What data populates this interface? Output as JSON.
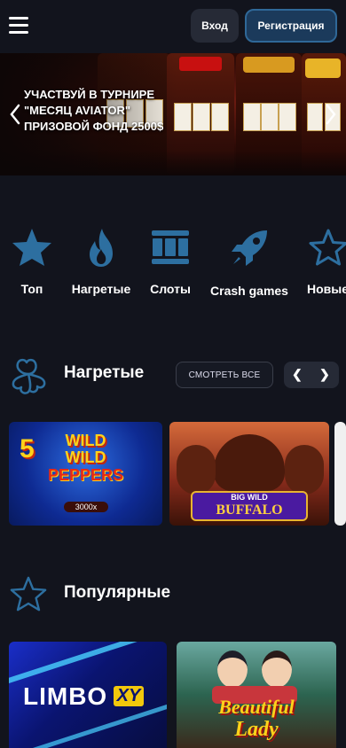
{
  "header": {
    "menu_icon": "hamburger-icon",
    "login_label": "Вход",
    "register_label": "Регистрация"
  },
  "banner": {
    "line1": "УЧАСТВУЙ В ТУРНИРЕ",
    "line2": "\"МЕСЯЦ AVIATOR\"",
    "line3": "ПРИЗОВОЙ ФОНД 2500$"
  },
  "categories": [
    {
      "label": "Топ",
      "icon": "star-icon"
    },
    {
      "label": "Нагретые",
      "icon": "flame-icon"
    },
    {
      "label": "Слоты",
      "icon": "slots-icon"
    },
    {
      "label": "Crash games",
      "icon": "rocket-icon"
    },
    {
      "label": "Новые",
      "icon": "star-outline-icon"
    }
  ],
  "sections": {
    "hot": {
      "title": "Нагретые",
      "see_all": "СМОТРЕТЬ ВСЕ",
      "icon": "clover-icon"
    },
    "popular": {
      "title": "Популярные",
      "icon": "star-outline-icon"
    }
  },
  "games": {
    "hot": [
      {
        "line1": "5",
        "line2": "WILD",
        "line3": "WILD",
        "line4": "PEPPERS",
        "badge": "3000x"
      },
      {
        "line1": "BIG WILD",
        "line2": "BUFFALO"
      }
    ],
    "popular": [
      {
        "line1": "LIMBO",
        "line2": "XY"
      },
      {
        "line1": "Beautiful",
        "line2": "Lady"
      }
    ]
  },
  "colors": {
    "background": "#12141d",
    "accent": "#2d6fa0",
    "button": "#262a36"
  }
}
